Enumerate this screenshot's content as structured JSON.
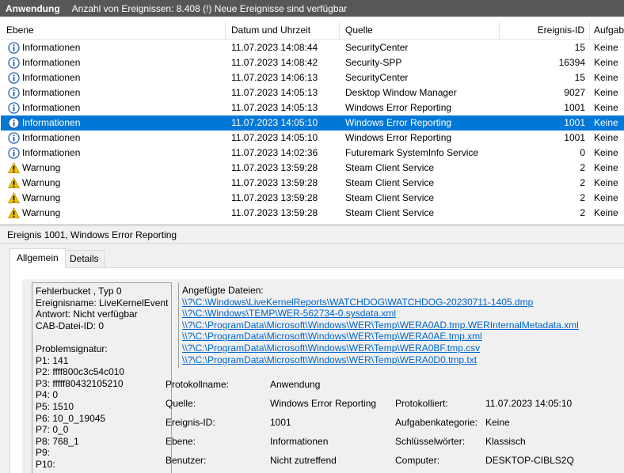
{
  "title": {
    "app": "Anwendung",
    "info": "Anzahl von Ereignissen: 8.408 (!) Neue Ereignisse sind verfügbar"
  },
  "columns": {
    "level": "Ebene",
    "date": "Datum und Uhrzeit",
    "source": "Quelle",
    "id": "Ereignis-ID",
    "task": "Aufgab"
  },
  "events": [
    {
      "type": "info",
      "level": "Informationen",
      "date": "11.07.2023 14:08:44",
      "source": "SecurityCenter",
      "id": "15",
      "task": "Keine"
    },
    {
      "type": "info",
      "level": "Informationen",
      "date": "11.07.2023 14:08:42",
      "source": "Security-SPP",
      "id": "16394",
      "task": "Keine"
    },
    {
      "type": "info",
      "level": "Informationen",
      "date": "11.07.2023 14:06:13",
      "source": "SecurityCenter",
      "id": "15",
      "task": "Keine"
    },
    {
      "type": "info",
      "level": "Informationen",
      "date": "11.07.2023 14:05:13",
      "source": "Desktop Window Manager",
      "id": "9027",
      "task": "Keine"
    },
    {
      "type": "info",
      "level": "Informationen",
      "date": "11.07.2023 14:05:13",
      "source": "Windows Error Reporting",
      "id": "1001",
      "task": "Keine"
    },
    {
      "type": "info",
      "level": "Informationen",
      "date": "11.07.2023 14:05:10",
      "source": "Windows Error Reporting",
      "id": "1001",
      "task": "Keine",
      "selected": true
    },
    {
      "type": "info",
      "level": "Informationen",
      "date": "11.07.2023 14:05:10",
      "source": "Windows Error Reporting",
      "id": "1001",
      "task": "Keine"
    },
    {
      "type": "info",
      "level": "Informationen",
      "date": "11.07.2023 14:02:36",
      "source": "Futuremark SystemInfo Service",
      "id": "0",
      "task": "Keine"
    },
    {
      "type": "warning",
      "level": "Warnung",
      "date": "11.07.2023 13:59:28",
      "source": "Steam Client Service",
      "id": "2",
      "task": "Keine"
    },
    {
      "type": "warning",
      "level": "Warnung",
      "date": "11.07.2023 13:59:28",
      "source": "Steam Client Service",
      "id": "2",
      "task": "Keine"
    },
    {
      "type": "warning",
      "level": "Warnung",
      "date": "11.07.2023 13:59:28",
      "source": "Steam Client Service",
      "id": "2",
      "task": "Keine"
    },
    {
      "type": "warning",
      "level": "Warnung",
      "date": "11.07.2023 13:59:28",
      "source": "Steam Client Service",
      "id": "2",
      "task": "Keine"
    }
  ],
  "detail": {
    "title": "Ereignis 1001, Windows Error Reporting",
    "tabs": {
      "general": "Allgemein",
      "details": "Details"
    },
    "description_lines": [
      "Fehlerbucket , Typ 0",
      "Ereignisname: LiveKernelEvent",
      "Antwort: Nicht verfügbar",
      "CAB-Datei-ID: 0",
      "",
      "Problemsignatur:",
      "P1: 141",
      "P2: ffff800c3c54c010",
      "P3: fffff80432105210",
      "P4: 0",
      "P5: 1510",
      "P6: 10_0_19045",
      "P7: 0_0",
      "P8: 768_1",
      "P9:",
      "P10:"
    ],
    "attached_files_label": "Angefügte Dateien:",
    "attached_files": [
      "\\\\?\\C:\\Windows\\LiveKernelReports\\WATCHDOG\\WATCHDOG-20230711-1405.dmp",
      "\\\\?\\C:\\Windows\\TEMP\\WER-562734-0.sysdata.xml",
      "\\\\?\\C:\\ProgramData\\Microsoft\\Windows\\WER\\Temp\\WERA0AD.tmp.WERInternalMetadata.xml",
      "\\\\?\\C:\\ProgramData\\Microsoft\\Windows\\WER\\Temp\\WERA0AE.tmp.xml",
      "\\\\?\\C:\\ProgramData\\Microsoft\\Windows\\WER\\Temp\\WERA0BF.tmp.csv",
      "\\\\?\\C:\\ProgramData\\Microsoft\\Windows\\WER\\Temp\\WERA0D0.tmp.txt"
    ],
    "props": {
      "log_name_label": "Protokollname:",
      "log_name": "Anwendung",
      "source_label": "Quelle:",
      "source": "Windows Error Reporting",
      "logged_label": "Protokolliert:",
      "logged": "11.07.2023 14:05:10",
      "event_id_label": "Ereignis-ID:",
      "event_id": "1001",
      "task_category_label": "Aufgabenkategorie:",
      "task_category": "Keine",
      "level_label": "Ebene:",
      "level": "Informationen",
      "keywords_label": "Schlüsselwörter:",
      "keywords": "Klassisch",
      "user_label": "Benutzer:",
      "user": "Nicht zutreffend",
      "computer_label": "Computer:",
      "computer": "DESKTOP-CIBLS2Q"
    }
  },
  "colors": {
    "selection": "#0078d7",
    "title_bar": "#575757",
    "info_icon": "#1e5aa8",
    "warning_icon": "#f2c200",
    "link": "#0066cc"
  }
}
